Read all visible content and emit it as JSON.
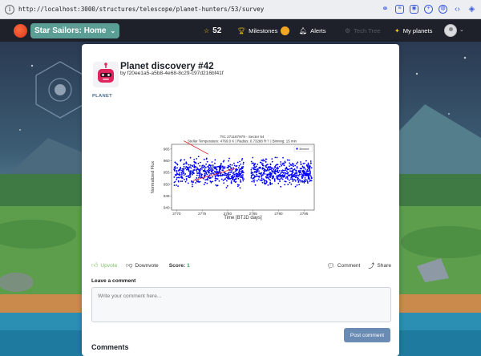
{
  "browser": {
    "url": "http://localhost:3000/structures/telescope/planet-hunters/53/survey"
  },
  "nav": {
    "home_label": "Star Sailors: Home",
    "stars_count": "52",
    "milestones_label": "Milestones",
    "alerts_label": "Alerts",
    "tech_tree_label": "Tech Tree",
    "my_planets_label": "My planets"
  },
  "post": {
    "title": "Planet discovery #42",
    "byline": "by f20ee1a5-a5b8-4e68-8c29-c97d216bf41f",
    "tag": "PLANET"
  },
  "chart_data": {
    "type": "scatter",
    "title": "TIC 271167979 - Sector 54",
    "subtitle": "Stellar Temperature: 4769.0 K | Radius: 0.73288 R☉ | Binning: 15 min",
    "xlabel": "Time [BTJD days]",
    "ylabel": "Normalized Flux",
    "legend": "Binned",
    "legend_position": "top-right",
    "xlim": [
      2769,
      2797
    ],
    "ylim": [
      939,
      967
    ],
    "x_ticks": [
      2770,
      2775,
      2780,
      2785,
      2790,
      2795
    ],
    "y_ticks": [
      940,
      945,
      950,
      955,
      960,
      965
    ],
    "series_color": "#0000ff",
    "segments": [
      [
        2769.5,
        2783.2
      ],
      [
        2784.6,
        2796.5
      ]
    ],
    "flux_center": 955,
    "flux_spread": 5.2,
    "annotation_color": "#e02020",
    "annotations": [
      {
        "x1": 2771.4,
        "y1": 968.5,
        "x2": 2776.2,
        "y2": 962.8
      },
      {
        "x1": 2773.2,
        "y1": 951.5,
        "x2": 2781.5,
        "y2": 956.8
      }
    ]
  },
  "actions": {
    "upvote_label": "Upvote",
    "downvote_label": "Downvote",
    "score_label": "Score:",
    "score_value": "1",
    "comment_label": "Comment",
    "share_label": "Share"
  },
  "comment_form": {
    "heading": "Leave a comment",
    "placeholder": "Write your comment here...",
    "submit_label": "Post comment"
  },
  "comments": {
    "heading": "Comments"
  }
}
